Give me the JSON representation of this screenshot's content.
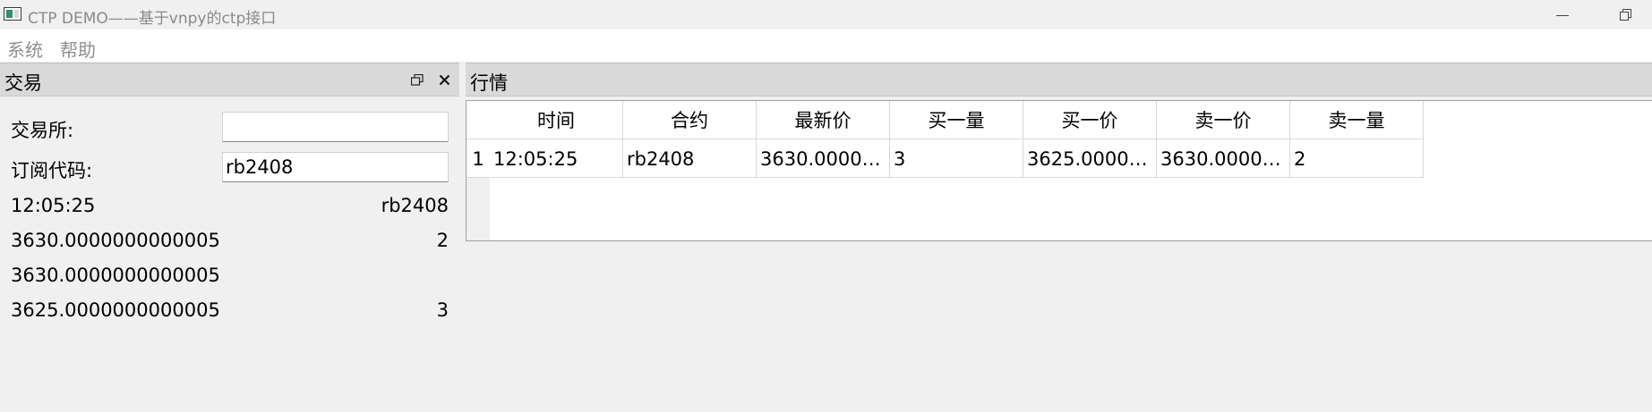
{
  "window": {
    "title": "CTP DEMO——基于vnpy的ctp接口",
    "icon": "app-window-icon"
  },
  "menu": {
    "items": [
      "系统",
      "帮助"
    ]
  },
  "trade_panel": {
    "title": "交易",
    "float_icon": "float-icon",
    "close_icon": "close-icon",
    "exchange_label": "交易所:",
    "exchange_value": "",
    "symbol_label": "订阅代码:",
    "symbol_value": "rb2408",
    "info_rows": [
      {
        "left": "12:05:25",
        "right": "rb2408"
      },
      {
        "left": "3630.0000000000005",
        "right": "2"
      },
      {
        "left": "3630.0000000000005",
        "right": ""
      },
      {
        "left": "3625.0000000000005",
        "right": "3"
      }
    ]
  },
  "market_panel": {
    "title": "行情",
    "columns": [
      "时间",
      "合约",
      "最新价",
      "买一量",
      "买一价",
      "卖一价",
      "卖一量"
    ],
    "rows": [
      {
        "index": "1",
        "cells": [
          "12:05:25",
          "rb2408",
          "3630.00000...",
          "3",
          "3625.00000...",
          "3630.00000...",
          "2"
        ]
      }
    ]
  }
}
